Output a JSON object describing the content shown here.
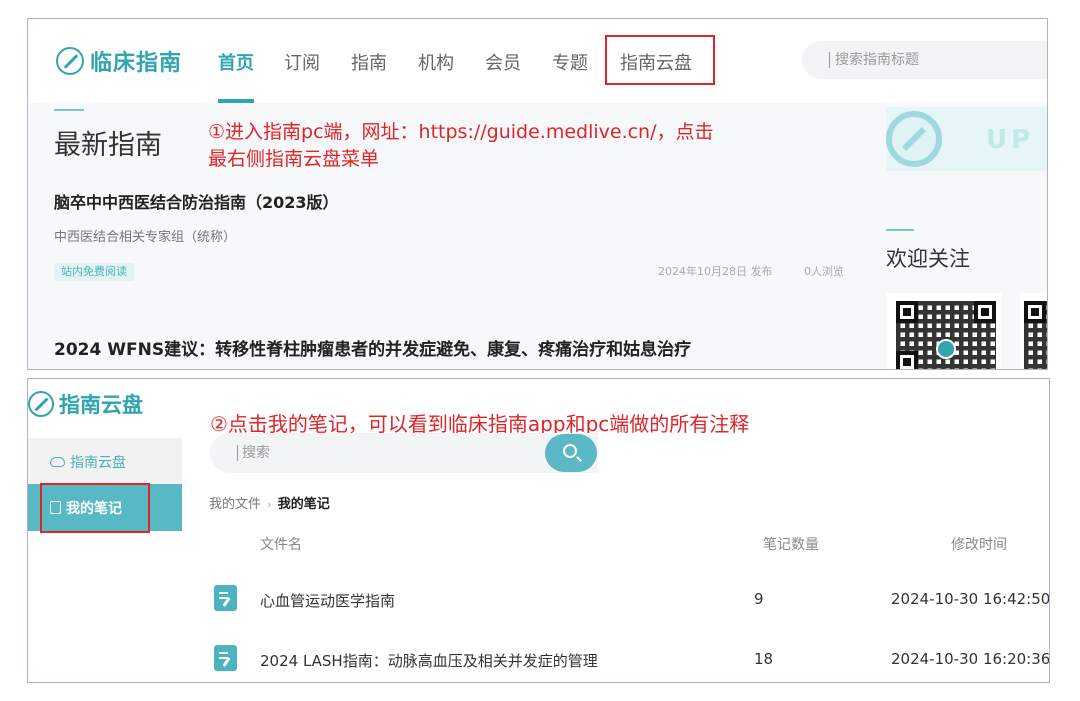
{
  "top_panel": {
    "logo": {
      "text": "临床指南",
      "icon": "compass-logo-icon"
    },
    "nav": [
      {
        "label": "首页",
        "active": true
      },
      {
        "label": "订阅"
      },
      {
        "label": "指南"
      },
      {
        "label": "机构"
      },
      {
        "label": "会员"
      },
      {
        "label": "专题"
      },
      {
        "label": "指南云盘",
        "highlighted": true
      }
    ],
    "search": {
      "placeholder": "搜索指南标题"
    },
    "section_title": "最新指南",
    "annotation1": {
      "line1": "①进入指南pc端，网址：https://guide.medlive.cn/，点击",
      "line2": "最右侧指南云盘菜单"
    },
    "articles": [
      {
        "title": "脑卒中中西医结合防治指南（2023版）",
        "author": "中西医结合相关专家组（统称）",
        "tag": "站内免费阅读",
        "date": "2024年10月28日 发布",
        "views": "0人浏览"
      },
      {
        "title": "2024 WFNS建议：转移性脊柱肿瘤患者的并发症避免、康复、疼痛治疗和姑息治疗"
      }
    ],
    "banner": {
      "text": "UP"
    },
    "follow_title": "欢迎关注"
  },
  "bottom_panel": {
    "logo": {
      "text": "指南云盘"
    },
    "annotation2": "②点击我的笔记，可以看到临床指南app和pc端做的所有注释",
    "sidebar": [
      {
        "label": "指南云盘",
        "icon": "cloud-icon",
        "active": false
      },
      {
        "label": "我的笔记",
        "icon": "notebook-icon",
        "active": true,
        "highlighted": true
      }
    ],
    "search": {
      "placeholder": "搜索"
    },
    "breadcrumb": {
      "parent": "我的文件",
      "separator": "›",
      "current": "我的笔记"
    },
    "table": {
      "headers": {
        "name": "文件名",
        "count": "笔记数量",
        "time": "修改时间"
      },
      "rows": [
        {
          "name": "心血管运动医学指南",
          "count": "9",
          "time": "2024-10-30 16:42:50"
        },
        {
          "name": "2024 LASH指南：动脉高血压及相关并发症的管理",
          "count": "18",
          "time": "2024-10-30 16:20:36"
        }
      ]
    }
  },
  "colors": {
    "brand": "#2fa5b0",
    "annotation": "#e0242a",
    "active_sidebar": "#58b8c4"
  }
}
